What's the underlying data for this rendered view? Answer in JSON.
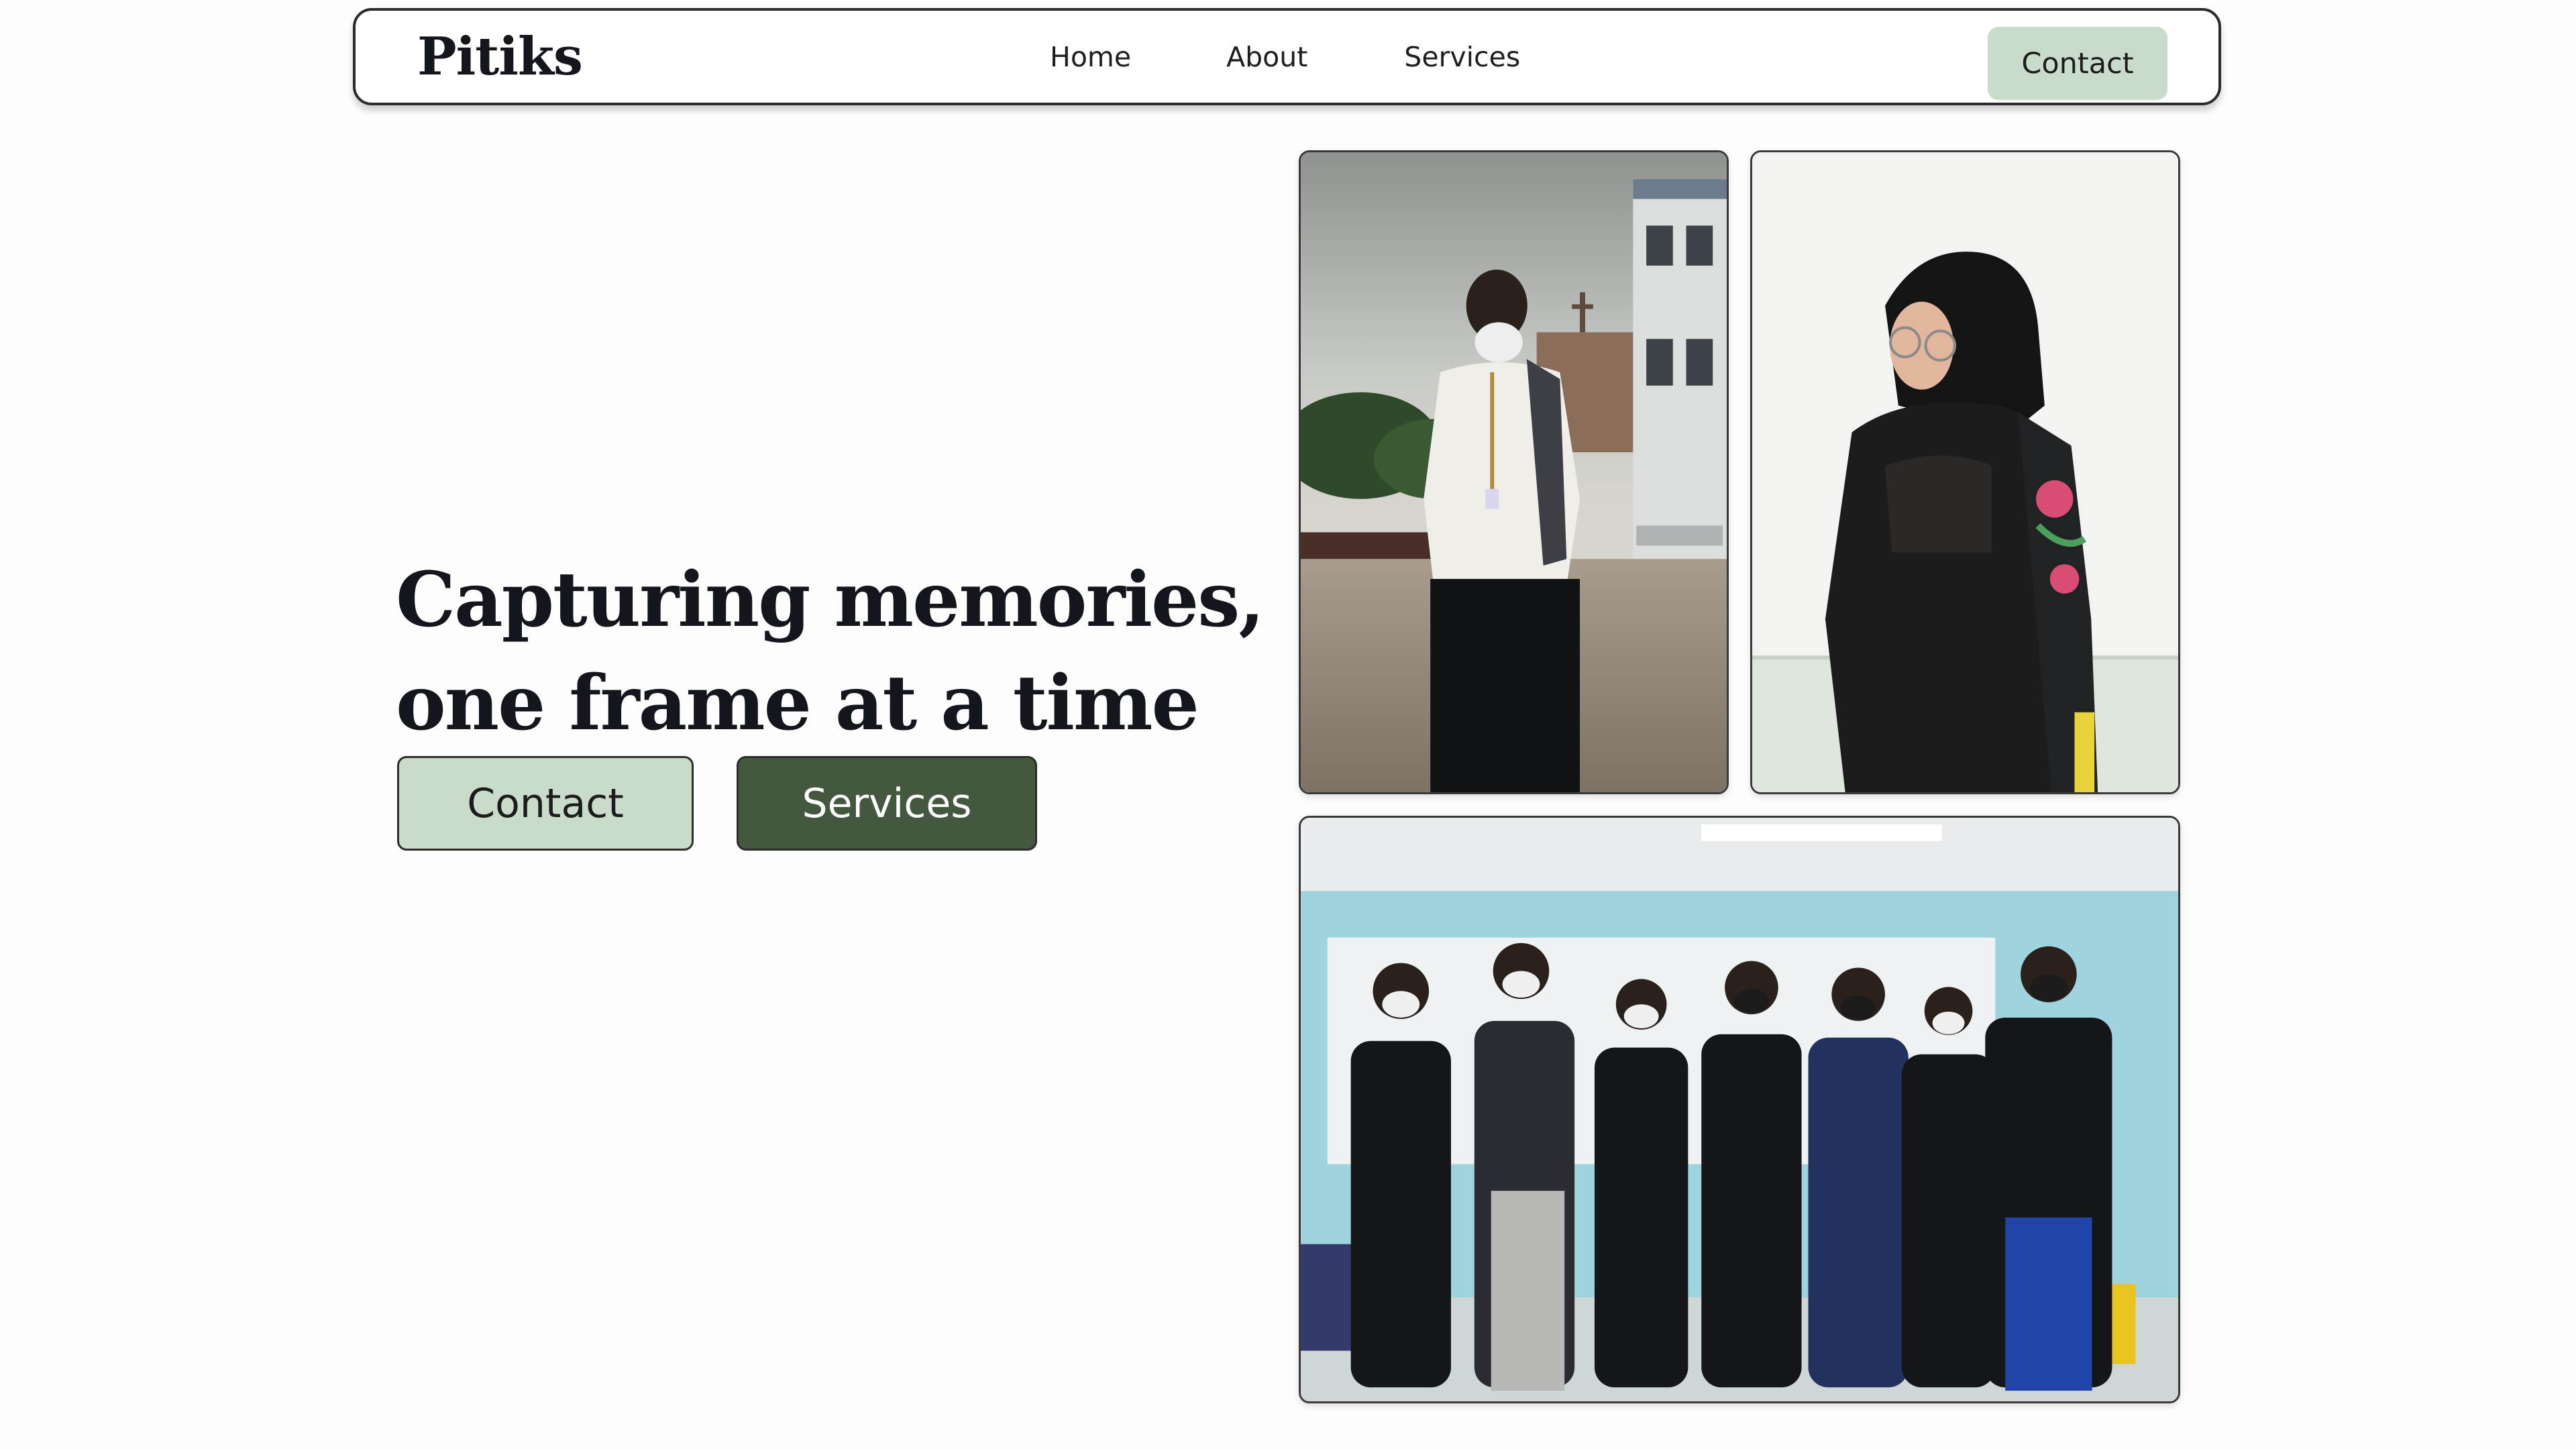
{
  "nav": {
    "logo": "Pitiks",
    "links": [
      "Home",
      "About",
      "Services"
    ],
    "contact_label": "Contact"
  },
  "hero": {
    "title_line1": "Capturing memories,",
    "title_line2": "one frame at a time",
    "contact_label": "Contact",
    "services_label": "Services"
  },
  "colors": {
    "accent_light": "#c8dcc9",
    "accent_dark": "#44573f",
    "text": "#14161e",
    "background": "#fdfdfd"
  },
  "photos": [
    {
      "subject": "student in white shirt with lanyard outdoors on a paved lot"
    },
    {
      "subject": "person in sheer black top looking over shoulder holding a printed scarf"
    },
    {
      "subject": "group of seven students in black outfits with arms crossed in a classroom"
    }
  ]
}
